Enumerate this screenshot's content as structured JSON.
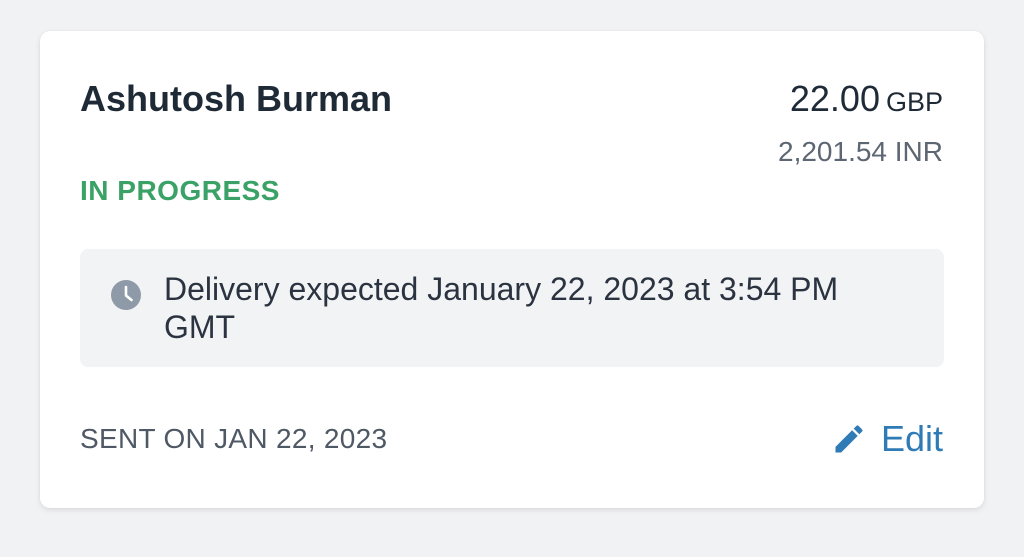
{
  "transfer": {
    "recipient_name": "Ashutosh Burman",
    "amount": {
      "value": "22.00",
      "currency": "GBP",
      "converted": "2,201.54 INR"
    },
    "status": "IN PROGRESS",
    "delivery": {
      "icon": "clock-icon",
      "text": "Delivery expected January 22, 2023 at 3:54 PM GMT"
    },
    "sent_label": "SENT ON JAN 22, 2023",
    "edit": {
      "icon": "pencil-icon",
      "label": "Edit"
    }
  },
  "colors": {
    "page_background": "#f1f2f4",
    "card_background": "#ffffff",
    "status_green": "#3aa266",
    "link_blue": "#2f7bb6",
    "icon_gray": "#8f9aa8",
    "box_background": "#f2f3f5"
  }
}
